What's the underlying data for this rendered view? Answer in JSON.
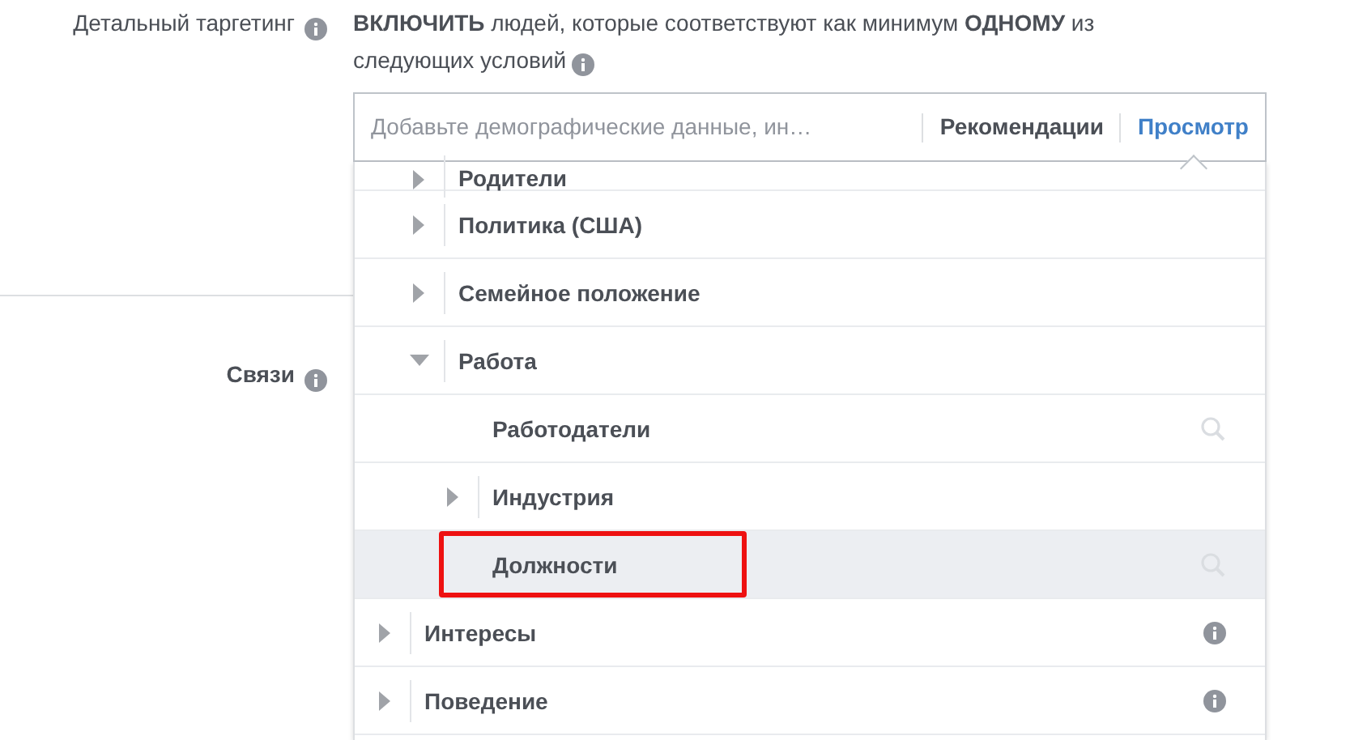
{
  "fields": [
    {
      "label": "Детальный таргетинг"
    },
    {
      "label": "Связи"
    }
  ],
  "detailed_targeting": {
    "heading": "**ВКЛЮЧИТЬ** людей, которые соответствуют как минимум **ОДНОМУ** из следующих условий",
    "search": {
      "placeholder": "Добавьте демографические данные, ин…"
    },
    "tabs": [
      {
        "label": "Рекомендации",
        "selected": false
      },
      {
        "label": "Просмотр",
        "selected": true
      }
    ],
    "tree": {
      "continued_children": [
        {
          "label": "Родители",
          "kind": "category",
          "expanded": false
        },
        {
          "label": "Политика (США)",
          "kind": "category",
          "expanded": false
        },
        {
          "label": "Семейное положение",
          "kind": "category",
          "expanded": false
        },
        {
          "label": "Работа",
          "kind": "category",
          "expanded": true,
          "children": [
            {
              "label": "Работодатели",
              "kind": "leaf",
              "selected": false,
              "highlighted": false
            },
            {
              "label": "Индустрия",
              "kind": "category",
              "expanded": false
            },
            {
              "label": "Должности",
              "kind": "leaf",
              "selected": true,
              "highlighted": true
            }
          ]
        }
      ],
      "items": [
        {
          "label": "Интересы",
          "kind": "category",
          "expanded": false
        },
        {
          "label": "Поведение",
          "kind": "category",
          "expanded": false
        }
      ]
    }
  }
}
